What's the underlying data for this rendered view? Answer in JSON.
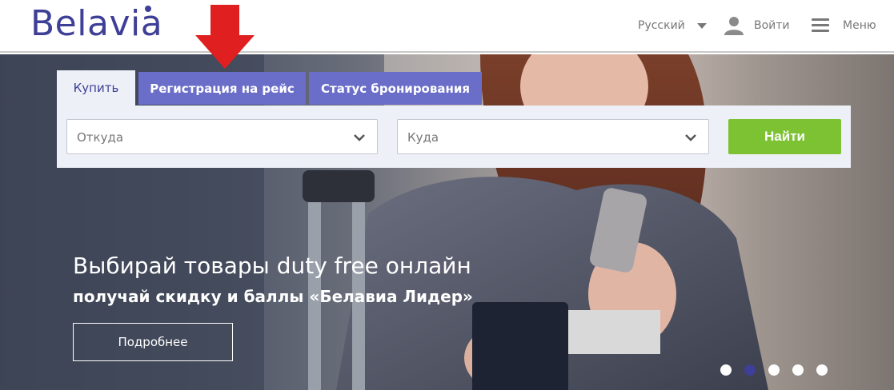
{
  "header": {
    "logo": "Belavia",
    "language": "Русский",
    "login": "Войти",
    "menu": "Меню"
  },
  "search": {
    "tabs": [
      {
        "label": "Купить",
        "active": true
      },
      {
        "label": "Регистрация на рейс",
        "active": false
      },
      {
        "label": "Статус бронирования",
        "active": false
      }
    ],
    "from_placeholder": "Откуда",
    "to_placeholder": "Куда",
    "find_label": "Найти"
  },
  "promo": {
    "title": "Выбирай товары duty free онлайн",
    "subtitle": "получай скидку и баллы «Белавиа Лидер»",
    "more_label": "Подробнее"
  },
  "carousel": {
    "slide_count": 5,
    "active_index": 1
  },
  "colors": {
    "brand": "#3e3f96",
    "tab_inactive": "#6a6ec9",
    "button_green": "#7cc233",
    "annotation_arrow": "#e02020"
  }
}
